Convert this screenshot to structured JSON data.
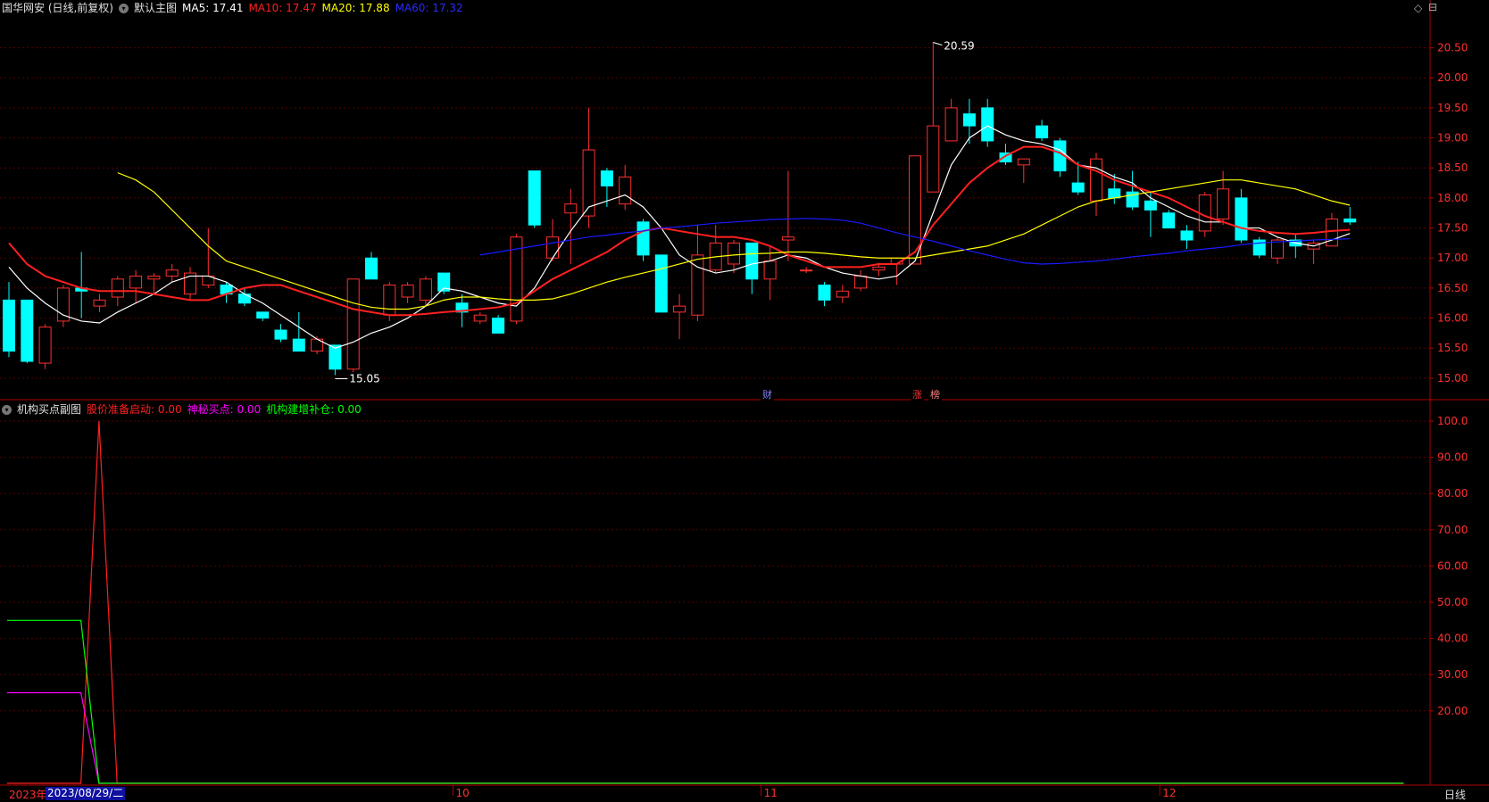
{
  "main_header": {
    "stock_title": "国华网安 (日线,前复权)",
    "indicator_name": "默认主图",
    "ma5": {
      "label": "MA5:",
      "value": "17.41",
      "color": "#ffffff"
    },
    "ma10": {
      "label": "MA10:",
      "value": "17.47",
      "color": "#ff2020"
    },
    "ma20": {
      "label": "MA20:",
      "value": "17.88",
      "color": "#ffff00"
    },
    "ma60": {
      "label": "MA60:",
      "value": "17.32",
      "color": "#1a1aff"
    }
  },
  "sub_header": {
    "indicator_name": "机构买点副图",
    "line1": {
      "label": "股价准备启动:",
      "value": "0.00",
      "color": "#ff2020"
    },
    "line2": {
      "label": "神秘买点:",
      "value": "0.00",
      "color": "#ff00ff"
    },
    "line3": {
      "label": "机构建增补仓:",
      "value": "0.00",
      "color": "#00ff00"
    }
  },
  "annotations": {
    "high_label": "20.59",
    "low_label": "15.05",
    "badge_cai": "财",
    "badge_zhang": "涨",
    "badge_bang": "榜"
  },
  "footer": {
    "year_label": "2023年",
    "cursor_date": "2023/08/29/二",
    "month_labels": [
      "10",
      "11",
      "12"
    ],
    "period_button": "日线"
  },
  "chart_data": [
    {
      "type": "candlestick",
      "ylim": [
        14.85,
        20.85
      ],
      "y_ticks": [
        "20.50",
        "20.00",
        "19.50",
        "19.00",
        "18.50",
        "18.00",
        "17.50",
        "17.00",
        "16.50",
        "16.00",
        "15.50",
        "15.00"
      ],
      "up_color": "#ff3030",
      "down_color": "#00ffff",
      "candles": [
        [
          16.3,
          16.6,
          15.35,
          15.45
        ],
        [
          16.3,
          16.3,
          15.25,
          15.28
        ],
        [
          15.25,
          15.9,
          15.15,
          15.85
        ],
        [
          15.95,
          16.55,
          15.85,
          16.5
        ],
        [
          16.5,
          17.1,
          16.0,
          16.45
        ],
        [
          16.2,
          16.4,
          16.1,
          16.3
        ],
        [
          16.35,
          16.7,
          16.2,
          16.65
        ],
        [
          16.5,
          16.8,
          16.25,
          16.7
        ],
        [
          16.65,
          16.75,
          16.4,
          16.7
        ],
        [
          16.7,
          16.9,
          16.6,
          16.8
        ],
        [
          16.4,
          16.85,
          16.3,
          16.75
        ],
        [
          16.55,
          17.5,
          16.5,
          16.7
        ],
        [
          16.55,
          16.6,
          16.25,
          16.4
        ],
        [
          16.4,
          16.5,
          16.2,
          16.25
        ],
        [
          16.1,
          16.1,
          15.95,
          16.0
        ],
        [
          15.8,
          15.9,
          15.6,
          15.65
        ],
        [
          15.65,
          16.1,
          15.5,
          15.45
        ],
        [
          15.45,
          15.7,
          15.4,
          15.65
        ],
        [
          15.55,
          15.55,
          15.05,
          15.15
        ],
        [
          15.15,
          16.65,
          15.1,
          16.65
        ],
        [
          17.0,
          17.1,
          16.65,
          16.65
        ],
        [
          16.05,
          16.6,
          15.95,
          16.55
        ],
        [
          16.35,
          16.6,
          16.25,
          16.55
        ],
        [
          16.3,
          16.7,
          16.2,
          16.65
        ],
        [
          16.75,
          16.75,
          16.4,
          16.45
        ],
        [
          16.25,
          16.4,
          15.85,
          16.1
        ],
        [
          15.95,
          16.1,
          15.9,
          16.05
        ],
        [
          16.0,
          16.05,
          15.75,
          15.75
        ],
        [
          15.95,
          17.4,
          15.9,
          17.35
        ],
        [
          18.45,
          18.45,
          17.5,
          17.55
        ],
        [
          17.0,
          17.65,
          16.95,
          17.35
        ],
        [
          17.75,
          18.15,
          16.9,
          17.9
        ],
        [
          17.7,
          19.5,
          17.5,
          18.8
        ],
        [
          18.45,
          18.5,
          17.85,
          18.2
        ],
        [
          17.9,
          18.55,
          17.8,
          18.35
        ],
        [
          17.6,
          17.65,
          16.95,
          17.05
        ],
        [
          17.05,
          17.05,
          16.1,
          16.1
        ],
        [
          16.1,
          16.4,
          15.65,
          16.2
        ],
        [
          16.05,
          17.55,
          15.95,
          17.05
        ],
        [
          16.8,
          17.55,
          16.75,
          17.25
        ],
        [
          16.9,
          17.3,
          16.75,
          17.25
        ],
        [
          17.25,
          17.25,
          16.4,
          16.65
        ],
        [
          16.65,
          17.2,
          16.3,
          16.95
        ],
        [
          17.3,
          18.45,
          16.95,
          17.35
        ],
        [
          16.8,
          16.85,
          16.75,
          16.8
        ],
        [
          16.55,
          16.6,
          16.2,
          16.3
        ],
        [
          16.35,
          16.55,
          16.25,
          16.45
        ],
        [
          16.5,
          16.8,
          16.45,
          16.7
        ],
        [
          16.8,
          16.9,
          16.7,
          16.85
        ],
        [
          16.9,
          17.0,
          16.55,
          17.0
        ],
        [
          16.9,
          18.7,
          16.9,
          18.7
        ],
        [
          18.1,
          20.59,
          18.1,
          19.2
        ],
        [
          18.95,
          19.65,
          18.95,
          19.5
        ],
        [
          19.4,
          19.65,
          18.9,
          19.2
        ],
        [
          19.5,
          19.65,
          18.85,
          18.95
        ],
        [
          18.75,
          18.9,
          18.55,
          18.6
        ],
        [
          18.55,
          18.65,
          18.25,
          18.65
        ],
        [
          19.2,
          19.3,
          18.95,
          19.0
        ],
        [
          18.95,
          19.0,
          18.35,
          18.45
        ],
        [
          18.25,
          18.6,
          18.05,
          18.1
        ],
        [
          17.95,
          18.75,
          17.7,
          18.65
        ],
        [
          18.15,
          18.4,
          17.9,
          18.0
        ],
        [
          18.1,
          18.45,
          17.8,
          17.85
        ],
        [
          17.95,
          18.1,
          17.35,
          17.8
        ],
        [
          17.75,
          17.8,
          17.5,
          17.5
        ],
        [
          17.45,
          17.55,
          17.15,
          17.3
        ],
        [
          17.45,
          18.1,
          17.35,
          18.05
        ],
        [
          17.65,
          18.45,
          17.55,
          18.15
        ],
        [
          18.0,
          18.15,
          17.25,
          17.3
        ],
        [
          17.3,
          17.35,
          17.0,
          17.05
        ],
        [
          17.0,
          17.35,
          16.9,
          17.3
        ],
        [
          17.3,
          17.4,
          17.0,
          17.2
        ],
        [
          17.15,
          17.3,
          16.9,
          17.25
        ],
        [
          17.2,
          17.75,
          17.2,
          17.65
        ],
        [
          17.65,
          17.85,
          17.55,
          17.6
        ]
      ],
      "series": [
        {
          "name": "MA5",
          "color": "#ffffff",
          "values": [
            16.85,
            16.5,
            16.25,
            16.05,
            15.95,
            15.92,
            16.1,
            16.25,
            16.4,
            16.6,
            16.7,
            16.7,
            16.6,
            16.4,
            16.25,
            16.05,
            15.85,
            15.65,
            15.5,
            15.6,
            15.75,
            15.85,
            16.0,
            16.2,
            16.5,
            16.45,
            16.35,
            16.25,
            16.2,
            16.5,
            17.0,
            17.45,
            17.85,
            17.95,
            18.05,
            17.85,
            17.5,
            17.05,
            16.85,
            16.75,
            16.8,
            16.9,
            16.95,
            17.05,
            17.0,
            16.85,
            16.75,
            16.7,
            16.65,
            16.7,
            16.95,
            17.75,
            18.55,
            19.0,
            19.2,
            19.05,
            18.95,
            18.9,
            18.8,
            18.55,
            18.5,
            18.35,
            18.25,
            18.0,
            17.85,
            17.7,
            17.6,
            17.6,
            17.5,
            17.5,
            17.35,
            17.25,
            17.2,
            17.3,
            17.41
          ]
        },
        {
          "name": "MA10",
          "color": "#ff2020",
          "values": [
            17.25,
            16.9,
            16.7,
            16.6,
            16.5,
            16.45,
            16.45,
            16.45,
            16.4,
            16.35,
            16.3,
            16.3,
            16.4,
            16.5,
            16.55,
            16.55,
            16.45,
            16.35,
            16.25,
            16.15,
            16.1,
            16.05,
            16.05,
            16.07,
            16.1,
            16.12,
            16.15,
            16.18,
            16.25,
            16.45,
            16.65,
            16.8,
            16.95,
            17.1,
            17.3,
            17.45,
            17.5,
            17.45,
            17.4,
            17.35,
            17.35,
            17.3,
            17.2,
            17.05,
            16.95,
            16.85,
            16.85,
            16.85,
            16.9,
            16.9,
            17.1,
            17.55,
            17.9,
            18.25,
            18.5,
            18.7,
            18.85,
            18.85,
            18.75,
            18.55,
            18.45,
            18.3,
            18.2,
            18.1,
            18.0,
            17.85,
            17.7,
            17.6,
            17.5,
            17.45,
            17.42,
            17.4,
            17.42,
            17.45,
            17.47
          ]
        },
        {
          "name": "MA20",
          "color": "#ffff00",
          "values": [
            18.42,
            18.3,
            18.1,
            17.8,
            17.5,
            17.2,
            16.95,
            16.85,
            16.75,
            16.65,
            16.55,
            16.45,
            16.35,
            16.25,
            16.18,
            16.15,
            16.15,
            16.2,
            16.3,
            16.35,
            16.35,
            16.32,
            16.3,
            16.3,
            16.32,
            16.4,
            16.5,
            16.6,
            16.68,
            16.75,
            16.82,
            16.9,
            16.98,
            17.02,
            17.05,
            17.07,
            17.08,
            17.1,
            17.1,
            17.08,
            17.05,
            17.02,
            17.0,
            17.0,
            17.0,
            17.05,
            17.1,
            17.15,
            17.2,
            17.3,
            17.4,
            17.55,
            17.7,
            17.85,
            17.95,
            18.0,
            18.05,
            18.1,
            18.15,
            18.2,
            18.25,
            18.3,
            18.3,
            18.25,
            18.2,
            18.15,
            18.05,
            17.95,
            17.88
          ]
        },
        {
          "name": "MA60",
          "color": "#1a1aff",
          "values": [
            17.05,
            17.1,
            17.15,
            17.2,
            17.25,
            17.3,
            17.35,
            17.38,
            17.42,
            17.45,
            17.5,
            17.52,
            17.55,
            17.58,
            17.6,
            17.62,
            17.64,
            17.65,
            17.66,
            17.65,
            17.63,
            17.58,
            17.5,
            17.42,
            17.35,
            17.28,
            17.2,
            17.12,
            17.05,
            16.98,
            16.92,
            16.9,
            16.91,
            16.93,
            16.95,
            16.98,
            17.02,
            17.05,
            17.08,
            17.12,
            17.15,
            17.18,
            17.22,
            17.25,
            17.27,
            17.28,
            17.3,
            17.31,
            17.32
          ]
        }
      ]
    },
    {
      "type": "line",
      "ylim": [
        0,
        100
      ],
      "y_ticks": [
        "100.0",
        "90.00",
        "80.00",
        "70.00",
        "60.00",
        "50.00",
        "40.00",
        "30.00",
        "20.00"
      ],
      "series": [
        {
          "name": "股价准备启动",
          "color": "#ff2020",
          "x": [
            0,
            2,
            3,
            4,
            75
          ],
          "values": [
            0,
            0,
            100,
            0,
            0
          ]
        },
        {
          "name": "神秘买点",
          "color": "#ff00ff",
          "x": [
            0,
            2,
            3,
            75
          ],
          "values": [
            25,
            25,
            0,
            0
          ]
        },
        {
          "name": "机构建增补仓",
          "color": "#00ff00",
          "x": [
            0,
            2,
            3,
            75
          ],
          "values": [
            45,
            45,
            0,
            0
          ]
        }
      ]
    }
  ]
}
